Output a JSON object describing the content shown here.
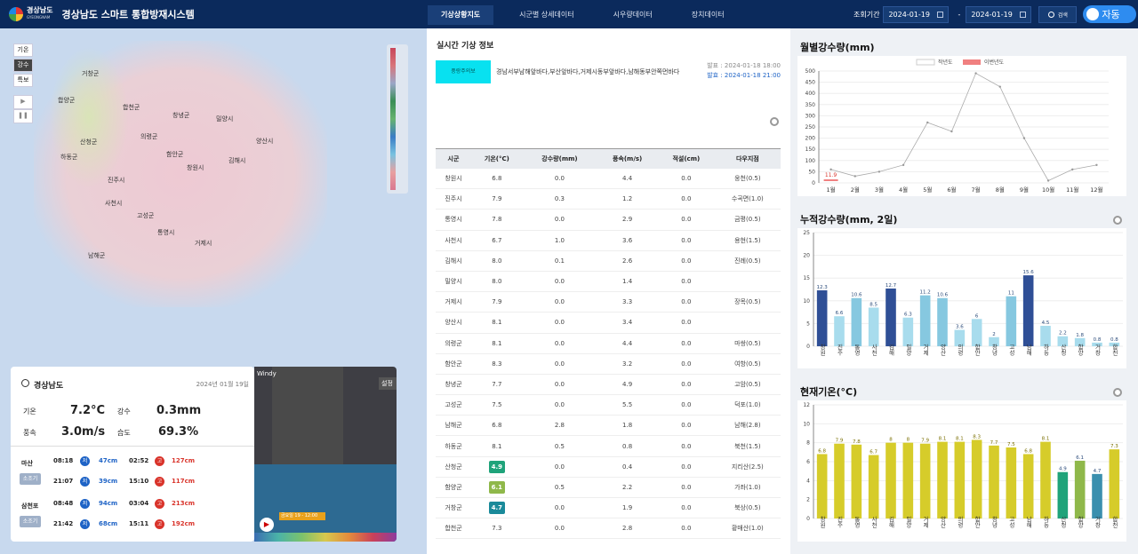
{
  "header": {
    "logo_line1": "경상남도",
    "logo_line2": "GYEONGNAM",
    "title": "경상남도 스마트 통합방재시스템",
    "tabs": [
      "기상상황지도",
      "시군별 상세데이터",
      "시우량데이터",
      "장치데이터"
    ],
    "period_label": "조회기간",
    "date_from": "2024-01-19",
    "date_to": "2024-01-19",
    "search_label": "검색",
    "auto_label": "자동"
  },
  "map": {
    "controls": [
      "기온",
      "강수",
      "특보"
    ],
    "places": [
      "거창군",
      "합양군",
      "합천군",
      "창녕군",
      "밀양시",
      "양산시",
      "산청군",
      "의령군",
      "함안군",
      "김해시",
      "창원시",
      "하동군",
      "진주시",
      "사천시",
      "고성군",
      "통영시",
      "거제시",
      "남해군"
    ]
  },
  "info": {
    "title": "경상남도",
    "date": "2024년 01월 19일",
    "temp_label": "기온",
    "temp": "7.2°C",
    "rain_label": "강수",
    "rain": "0.3mm",
    "wind_label": "풍속",
    "wind": "3.0m/s",
    "hum_label": "습도",
    "hum": "69.3%",
    "tides": [
      {
        "station": "마산",
        "tag": "소조기",
        "rows": [
          [
            "08:18",
            "저",
            "47cm",
            "02:52",
            "고",
            "127cm"
          ],
          [
            "21:07",
            "저",
            "39cm",
            "15:10",
            "고",
            "117cm"
          ]
        ]
      },
      {
        "station": "삼천포",
        "tag": "소조기",
        "rows": [
          [
            "08:48",
            "저",
            "94cm",
            "03:04",
            "고",
            "213cm"
          ],
          [
            "21:42",
            "저",
            "68cm",
            "15:11",
            "고",
            "192cm"
          ]
        ]
      }
    ]
  },
  "windy": {
    "logo": "Windy",
    "settings": "설정",
    "time": "금요일 19 - 12:00"
  },
  "realtime": {
    "title": "실시간 기상 정보",
    "warning_tag": "풍랑주의보",
    "warning_text": "경남서부남해앞바다,부산앞바다,거제시동부앞바다,남해동부안쪽먼바다",
    "issued": "발표 : 2024-01-18 18:00",
    "effective": "발효 : 2024-01-18 21:00",
    "columns": [
      "시군",
      "기온(°C)",
      "강수량(mm)",
      "풍속(m/s)",
      "적설(cm)",
      "다우지점"
    ],
    "rows": [
      [
        "창원시",
        "6.8",
        "0.0",
        "4.4",
        "0.0",
        "웅천(0.5)"
      ],
      [
        "진주시",
        "7.9",
        "0.3",
        "1.2",
        "0.0",
        "수곡면(1.0)"
      ],
      [
        "통영시",
        "7.8",
        "0.0",
        "2.9",
        "0.0",
        "금평(0.5)"
      ],
      [
        "사천시",
        "6.7",
        "1.0",
        "3.6",
        "0.0",
        "용현(1.5)"
      ],
      [
        "김해시",
        "8.0",
        "0.1",
        "2.6",
        "0.0",
        "진례(0.5)"
      ],
      [
        "밀양시",
        "8.0",
        "0.0",
        "1.4",
        "0.0",
        ""
      ],
      [
        "거제시",
        "7.9",
        "0.0",
        "3.3",
        "0.0",
        "장목(0.5)"
      ],
      [
        "양산시",
        "8.1",
        "0.0",
        "3.4",
        "0.0",
        ""
      ],
      [
        "의령군",
        "8.1",
        "0.0",
        "4.4",
        "0.0",
        "마쌍(0.5)"
      ],
      [
        "함안군",
        "8.3",
        "0.0",
        "3.2",
        "0.0",
        "여항(0.5)"
      ],
      [
        "창녕군",
        "7.7",
        "0.0",
        "4.9",
        "0.0",
        "고암(0.5)"
      ],
      [
        "고성군",
        "7.5",
        "0.0",
        "5.5",
        "0.0",
        "덕포(1.0)"
      ],
      [
        "남해군",
        "6.8",
        "2.8",
        "1.8",
        "0.0",
        "남해(2.8)"
      ],
      [
        "하동군",
        "8.1",
        "0.5",
        "0.8",
        "0.0",
        "북천(1.5)"
      ],
      [
        "산청군",
        "4.9",
        "0.0",
        "0.4",
        "0.0",
        "지리산(2.5)"
      ],
      [
        "함양군",
        "6.1",
        "0.5",
        "2.2",
        "0.0",
        "가좌(1.0)"
      ],
      [
        "거창군",
        "4.7",
        "0.0",
        "1.9",
        "0.0",
        "북상(0.5)"
      ],
      [
        "합천군",
        "7.3",
        "0.0",
        "2.8",
        "0.0",
        "황매산(1.0)"
      ]
    ],
    "badges": {
      "14": "#1fa37a",
      "15": "#8fb84a",
      "16": "#1a8a9a"
    }
  },
  "chart_data": [
    {
      "type": "line",
      "title": "월별강수량(mm)",
      "x": [
        "1월",
        "2월",
        "3월",
        "4월",
        "5월",
        "6월",
        "7월",
        "8월",
        "9월",
        "10월",
        "11월",
        "12월"
      ],
      "series": [
        {
          "name": "작년도",
          "values": [
            60,
            30,
            50,
            80,
            270,
            230,
            490,
            430,
            200,
            10,
            60,
            80
          ]
        },
        {
          "name": "이번년도",
          "values": [
            11.9
          ]
        }
      ],
      "ylim": [
        0,
        500
      ],
      "yticks": [
        0,
        50,
        100,
        150,
        200,
        250,
        300,
        350,
        400,
        450,
        500
      ],
      "label": "11.9"
    },
    {
      "type": "bar",
      "title": "누적강수량(mm, 2일)",
      "categories": [
        "창원",
        "진주",
        "통영",
        "사천",
        "김해",
        "밀양",
        "거제",
        "양산",
        "의령",
        "함안",
        "창녕",
        "고성",
        "남해",
        "하동",
        "산청",
        "함양",
        "거창",
        "합천"
      ],
      "values": [
        12.3,
        6.6,
        10.6,
        8.5,
        12.7,
        6.3,
        11.2,
        10.6,
        3.6,
        6.0,
        2.0,
        11.0,
        15.6,
        4.5,
        2.2,
        1.8,
        0.8,
        0.8
      ],
      "ylim": [
        0,
        25
      ],
      "yticks": [
        0,
        5,
        10,
        15,
        20,
        25
      ]
    },
    {
      "type": "bar",
      "title": "현재기온(°C)",
      "categories": [
        "창원",
        "진주",
        "통영",
        "사천",
        "김해",
        "밀양",
        "거제",
        "양산",
        "의령",
        "함안",
        "창녕",
        "고성",
        "남해",
        "하동",
        "산청",
        "함양",
        "거창",
        "합천"
      ],
      "values": [
        6.8,
        7.9,
        7.8,
        6.7,
        8.0,
        8.0,
        7.9,
        8.1,
        8.1,
        8.3,
        7.7,
        7.5,
        6.8,
        8.1,
        4.9,
        6.1,
        4.7,
        7.3
      ],
      "ylim": [
        0,
        12
      ],
      "yticks": [
        0,
        2,
        4,
        6,
        8,
        10,
        12
      ]
    }
  ]
}
